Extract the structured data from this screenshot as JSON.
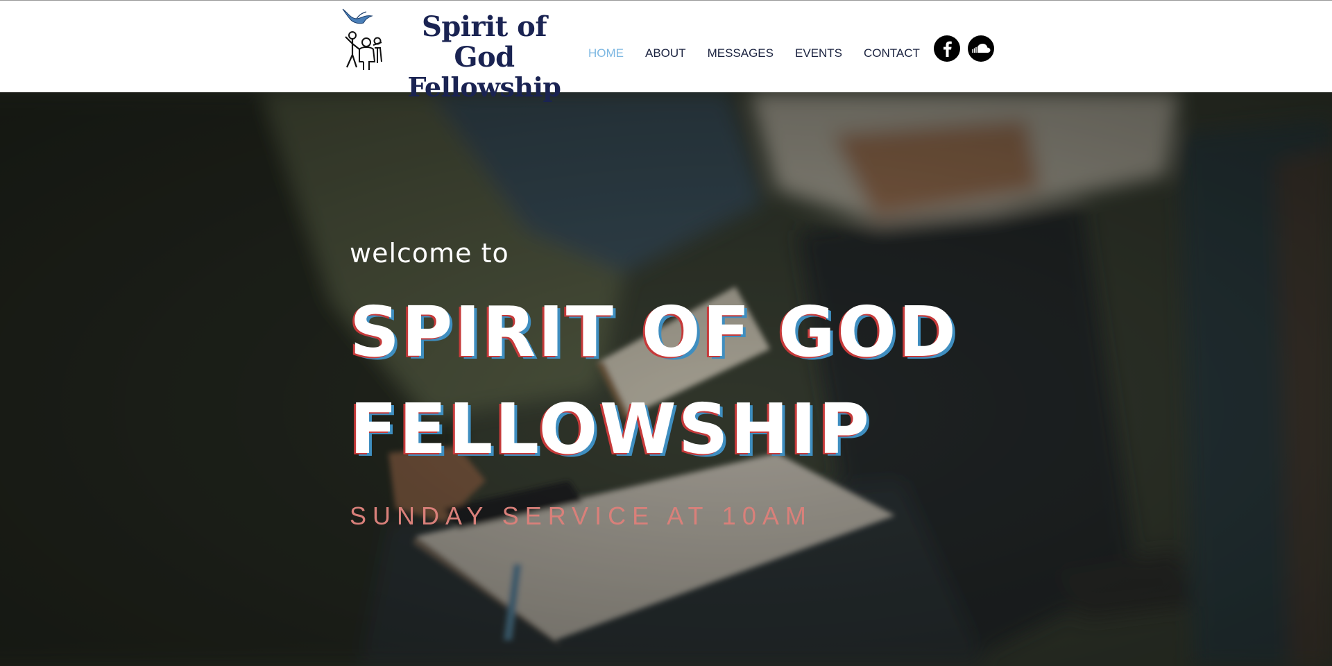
{
  "header": {
    "logo": {
      "line1": "Spirit of God",
      "line2": "Fellowship",
      "emblem_icon": "dove-and-people-icon",
      "color": "#1a2352"
    },
    "nav": [
      {
        "label": "HOME",
        "active": true
      },
      {
        "label": "ABOUT",
        "active": false
      },
      {
        "label": "MESSAGES",
        "active": false
      },
      {
        "label": "EVENTS",
        "active": false
      },
      {
        "label": "CONTACT",
        "active": false
      }
    ],
    "social": [
      {
        "name": "facebook-icon"
      },
      {
        "name": "soundcloud-icon"
      }
    ],
    "active_color": "#7cb7e2",
    "nav_color": "#1b2340"
  },
  "hero": {
    "welcome": "welcome to",
    "title_line1": "SPIRIT OF GOD",
    "title_line2": "FELLOWSHIP",
    "service": "SUNDAY SERVICE AT 10AM",
    "service_color": "#d9807a",
    "background": "photo of congregation seated with open bibles"
  }
}
